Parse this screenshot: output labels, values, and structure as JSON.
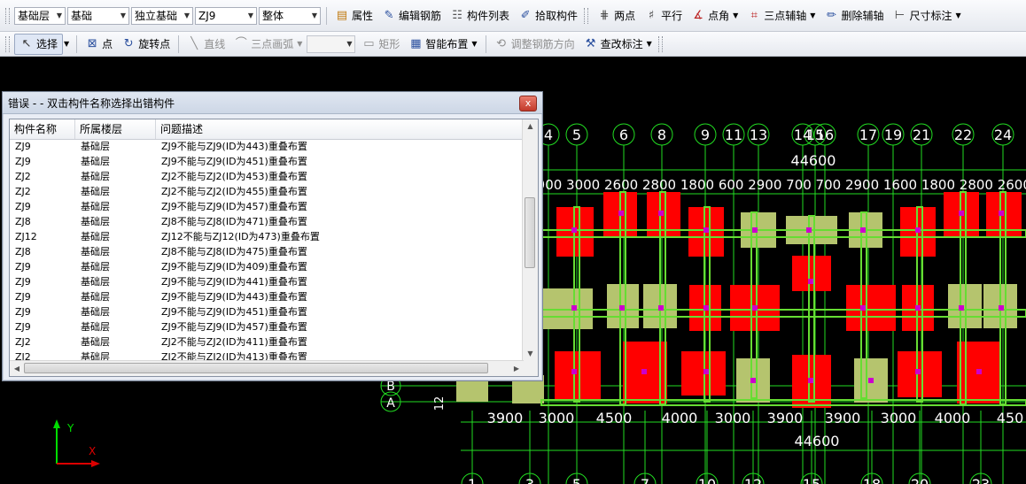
{
  "toolbar1": {
    "floor_combo": "基础层",
    "category_combo": "基础",
    "type_combo": "独立基础",
    "component_combo": "ZJ9",
    "scope_combo": "整体",
    "buttons": {
      "properties": "属性",
      "edit_rebar": "编辑钢筋",
      "component_list": "构件列表",
      "pick_component": "拾取构件",
      "two_points": "两点",
      "parallel": "平行",
      "point_angle": "点角",
      "three_point_axis": "三点辅轴",
      "delete_axis": "删除辅轴",
      "dimension": "尺寸标注"
    }
  },
  "toolbar2": {
    "select": "选择",
    "point": "点",
    "rotate_point": "旋转点",
    "line": "直线",
    "three_point_arc": "三点画弧",
    "arc_combo": "",
    "rectangle": "矩形",
    "smart_layout": "智能布置",
    "adjust_rebar_direction": "调整钢筋方向",
    "check_annotation": "查改标注"
  },
  "dialog": {
    "title": "错误 - - 双击构件名称选择出错构件",
    "close_label": "x",
    "columns": [
      "构件名称",
      "所属楼层",
      "问题描述"
    ],
    "rows": [
      [
        "ZJ9",
        "基础层",
        "ZJ9不能与ZJ9(ID为443)重叠布置"
      ],
      [
        "ZJ9",
        "基础层",
        "ZJ9不能与ZJ9(ID为451)重叠布置"
      ],
      [
        "ZJ2",
        "基础层",
        "ZJ2不能与ZJ2(ID为453)重叠布置"
      ],
      [
        "ZJ2",
        "基础层",
        "ZJ2不能与ZJ2(ID为455)重叠布置"
      ],
      [
        "ZJ9",
        "基础层",
        "ZJ9不能与ZJ9(ID为457)重叠布置"
      ],
      [
        "ZJ8",
        "基础层",
        "ZJ8不能与ZJ8(ID为471)重叠布置"
      ],
      [
        "ZJ12",
        "基础层",
        "ZJ12不能与ZJ12(ID为473)重叠布置"
      ],
      [
        "ZJ8",
        "基础层",
        "ZJ8不能与ZJ8(ID为475)重叠布置"
      ],
      [
        "ZJ9",
        "基础层",
        "ZJ9不能与ZJ9(ID为409)重叠布置"
      ],
      [
        "ZJ9",
        "基础层",
        "ZJ9不能与ZJ9(ID为441)重叠布置"
      ],
      [
        "ZJ9",
        "基础层",
        "ZJ9不能与ZJ9(ID为443)重叠布置"
      ],
      [
        "ZJ9",
        "基础层",
        "ZJ9不能与ZJ9(ID为451)重叠布置"
      ],
      [
        "ZJ9",
        "基础层",
        "ZJ9不能与ZJ9(ID为457)重叠布置"
      ],
      [
        "ZJ2",
        "基础层",
        "ZJ2不能与ZJ2(ID为411)重叠布置"
      ],
      [
        "ZJ2",
        "基础层",
        "ZJ2不能与ZJ2(ID为413)重叠布置"
      ]
    ]
  },
  "canvas": {
    "top_axis_labels": [
      "4",
      "5",
      "6",
      "8",
      "9",
      "11",
      "13",
      "14",
      "15",
      "16",
      "17",
      "19",
      "21",
      "22",
      "24"
    ],
    "top_total": "44600",
    "top_dimension_text": "00 1900 3000 2600 2800 1800 600 2900 700 700 2900 1600 1800 2800 2600 30",
    "bottom_dims": [
      "3900",
      "3000",
      "4500",
      "4000",
      "3000",
      "3900",
      "3900",
      "3000",
      "4000",
      "450"
    ],
    "bottom_total": "44600",
    "bottom_axis_labels": [
      "1",
      "3",
      "5",
      "7",
      "10",
      "12",
      "15",
      "18",
      "20",
      "23"
    ],
    "row_labels": [
      "B",
      "A"
    ],
    "side_dim": "12",
    "ucs_y": "Y",
    "ucs_x": "X",
    "colors": {
      "axis": "#22dd22",
      "footing_red": "#ff0000",
      "footing_olive": "#b5c46e",
      "beam": "#66dd33",
      "marker": "#cc00cc",
      "text": "#ffffff"
    }
  }
}
